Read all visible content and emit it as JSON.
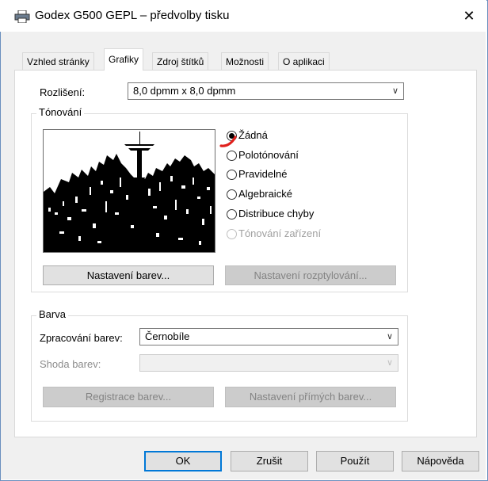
{
  "window": {
    "title": "Godex G500 GEPL – předvolby tisku",
    "close_symbol": "✕"
  },
  "tabs": [
    {
      "label": "Vzhled stránky",
      "active": false
    },
    {
      "label": "Grafiky",
      "active": true
    },
    {
      "label": "Zdroj štítků",
      "active": false
    },
    {
      "label": "Možnosti",
      "active": false
    },
    {
      "label": "O aplikaci",
      "active": false
    }
  ],
  "resolution": {
    "label": "Rozlišení:",
    "value": "8,0 dpmm x 8,0 dpmm"
  },
  "dithering": {
    "group_title": "Tónování",
    "options": [
      {
        "label": "Žádná",
        "checked": true,
        "enabled": true
      },
      {
        "label": "Polotónování",
        "checked": false,
        "enabled": true
      },
      {
        "label": "Pravidelné",
        "checked": false,
        "enabled": true
      },
      {
        "label": "Algebraické",
        "checked": false,
        "enabled": true
      },
      {
        "label": "Distribuce chyby",
        "checked": false,
        "enabled": true
      },
      {
        "label": "Tónování zařízení",
        "checked": false,
        "enabled": false
      }
    ],
    "color_settings_button": "Nastavení barev...",
    "dither_settings_button": "Nastavení rozptylování..."
  },
  "color": {
    "group_title": "Barva",
    "processing_label": "Zpracování barev:",
    "processing_value": "Černobíle",
    "match_label": "Shoda barev:",
    "match_value": "",
    "registration_button": "Registrace barev...",
    "direct_colors_button": "Nastavení přímých barev..."
  },
  "footer": {
    "ok": "OK",
    "cancel": "Zrušit",
    "apply": "Použít",
    "help": "Nápověda"
  },
  "colors": {
    "accent": "#0078d7",
    "annotation": "#e0201c"
  }
}
